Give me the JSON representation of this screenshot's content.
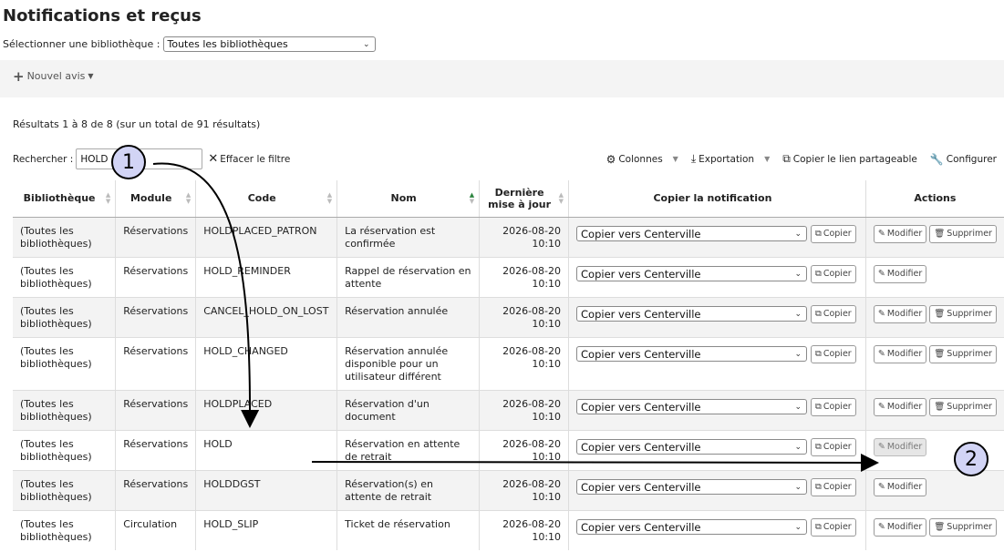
{
  "page": {
    "title": "Notifications et reçus"
  },
  "library_filter": {
    "label": "Sélectionner une bibliothèque :",
    "selected": "Toutes les bibliothèques"
  },
  "toolbar": {
    "new_notice": "Nouvel avis"
  },
  "results": {
    "info": "Résultats 1 à 8 de 8 (sur un total de 91 résultats)"
  },
  "search": {
    "label": "Rechercher :",
    "value": "HOLD",
    "clear_filter": "Effacer le filtre"
  },
  "table_tools": {
    "columns": "Colonnes",
    "export": "Exportation",
    "copy_link": "Copier le lien partageable",
    "configure": "Configurer"
  },
  "table": {
    "headers": {
      "library": "Bibliothèque",
      "module": "Module",
      "code": "Code",
      "name": "Nom",
      "updated": "Dernière mise à jour",
      "copy": "Copier la notification",
      "actions": "Actions"
    },
    "copy_target": "Copier vers Centerville",
    "copy_button": "Copier",
    "edit_button": "Modifier",
    "delete_button": "Supprimer",
    "rows": [
      {
        "library": "(Toutes les bibliothèques)",
        "module": "Réservations",
        "code": "HOLDPLACED_PATRON",
        "name": "La réservation est confirmée",
        "date": "2026-08-20",
        "time": "10:10",
        "deletable": true
      },
      {
        "library": "(Toutes les bibliothèques)",
        "module": "Réservations",
        "code": "HOLD_REMINDER",
        "name": "Rappel de réservation en attente",
        "date": "2026-08-20",
        "time": "10:10",
        "deletable": false
      },
      {
        "library": "(Toutes les bibliothèques)",
        "module": "Réservations",
        "code": "CANCEL_HOLD_ON_LOST",
        "name": "Réservation annulée",
        "date": "2026-08-20",
        "time": "10:10",
        "deletable": true
      },
      {
        "library": "(Toutes les bibliothèques)",
        "module": "Réservations",
        "code": "HOLD_CHANGED",
        "name": "Réservation annulée disponible pour un utilisateur différent",
        "date": "2026-08-20",
        "time": "10:10",
        "deletable": true
      },
      {
        "library": "(Toutes les bibliothèques)",
        "module": "Réservations",
        "code": "HOLDPLACED",
        "name": "Réservation d'un document",
        "date": "2026-08-20",
        "time": "10:10",
        "deletable": true
      },
      {
        "library": "(Toutes les bibliothèques)",
        "module": "Réservations",
        "code": "HOLD",
        "name": "Réservation en attente de retrait",
        "date": "2026-08-20",
        "time": "10:10",
        "deletable": false
      },
      {
        "library": "(Toutes les bibliothèques)",
        "module": "Réservations",
        "code": "HOLDDGST",
        "name": "Réservation(s) en attente de retrait",
        "date": "2026-08-20",
        "time": "10:10",
        "deletable": false
      },
      {
        "library": "(Toutes les bibliothèques)",
        "module": "Circulation",
        "code": "HOLD_SLIP",
        "name": "Ticket de réservation",
        "date": "2026-08-20",
        "time": "10:10",
        "deletable": true
      }
    ]
  },
  "annotations": {
    "step1": "1",
    "step2": "2"
  }
}
